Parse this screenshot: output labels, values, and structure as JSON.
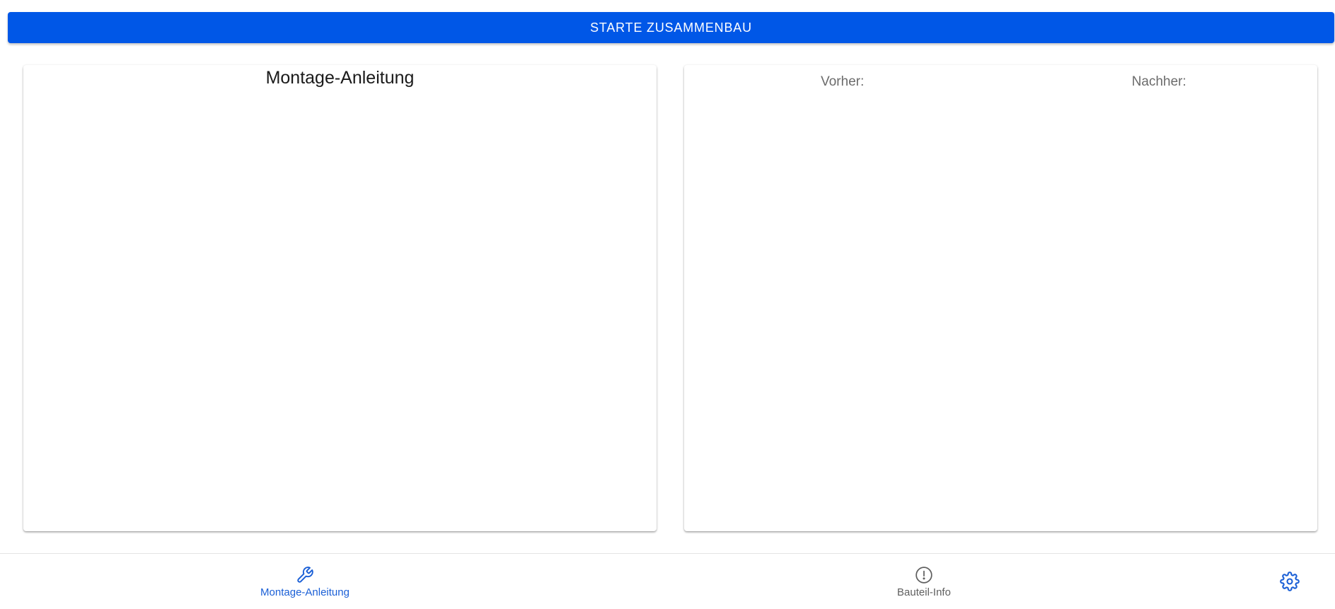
{
  "header": {
    "start_button_label": "STARTE ZUSAMMENBAU"
  },
  "instructions_card": {
    "title": "Montage-Anleitung"
  },
  "comparison_card": {
    "before_label": "Vorher:",
    "after_label": "Nachher:"
  },
  "bottom_nav": {
    "items": [
      {
        "label": "Montage-Anleitung",
        "icon": "wrench-icon",
        "active": true
      },
      {
        "label": "Bauteil-Info",
        "icon": "alert-circle-icon",
        "active": false
      }
    ],
    "settings_icon": "gear-icon"
  },
  "colors": {
    "primary": "#0057e7",
    "active_nav": "#1a5fd6",
    "inactive_nav": "#5f5f5f"
  }
}
